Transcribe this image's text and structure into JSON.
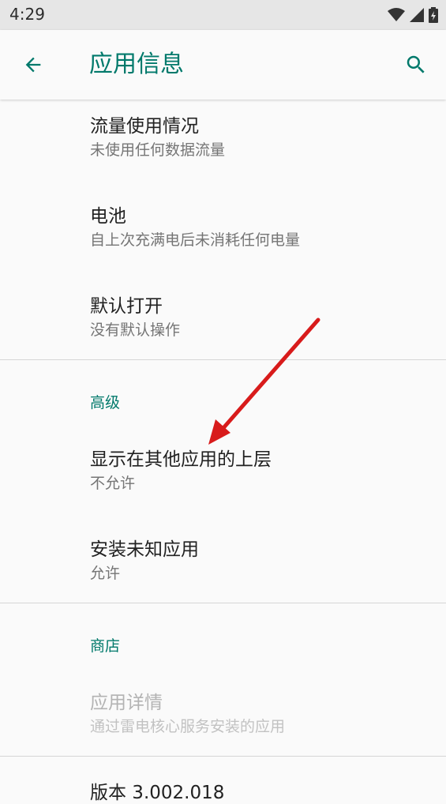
{
  "status_bar": {
    "time": "4:29"
  },
  "app_bar": {
    "title": "应用信息",
    "back_icon": "arrow-back-icon",
    "search_icon": "search-icon",
    "accent_color": "#00796b"
  },
  "items": {
    "data_usage": {
      "title": "流量使用情况",
      "summary": "未使用任何数据流量"
    },
    "battery": {
      "title": "电池",
      "summary": "自上次充满电后未消耗任何电量"
    },
    "open_by_default": {
      "title": "默认打开",
      "summary": "没有默认操作"
    }
  },
  "advanced": {
    "header": "高级",
    "overlay": {
      "title": "显示在其他应用的上层",
      "summary": "不允许"
    },
    "install_unknown": {
      "title": "安装未知应用",
      "summary": "允许"
    }
  },
  "store": {
    "header": "商店",
    "app_details": {
      "title": "应用详情",
      "summary": "通过雷电核心服务安装的应用"
    }
  },
  "version": "版本 3.002.018",
  "annotation": {
    "type": "red-arrow",
    "color": "#d81b1b"
  }
}
